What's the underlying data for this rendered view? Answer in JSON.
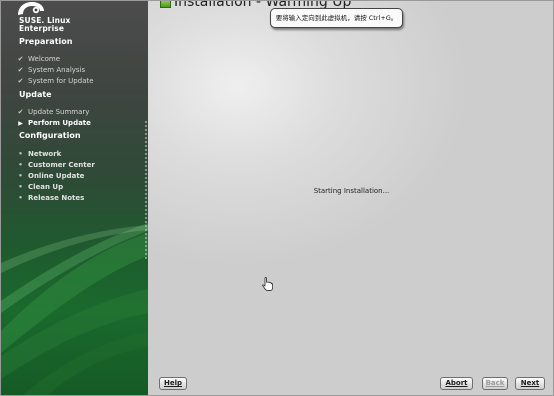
{
  "brand": {
    "line1": "SUSE. Linux",
    "line2": "Enterprise"
  },
  "sidebar": {
    "sections": [
      {
        "title": "Preparation",
        "items": [
          {
            "label": "Welcome",
            "state": "done"
          },
          {
            "label": "System Analysis",
            "state": "done"
          },
          {
            "label": "System for Update",
            "state": "done"
          }
        ]
      },
      {
        "title": "Update",
        "items": [
          {
            "label": "Update Summary",
            "state": "done"
          },
          {
            "label": "Perform Update",
            "state": "current"
          }
        ]
      },
      {
        "title": "Configuration",
        "items": [
          {
            "label": "Network",
            "state": "todo"
          },
          {
            "label": "Customer Center",
            "state": "todo"
          },
          {
            "label": "Online Update",
            "state": "todo"
          },
          {
            "label": "Clean Up",
            "state": "todo"
          },
          {
            "label": "Release Notes",
            "state": "todo"
          }
        ]
      }
    ]
  },
  "main": {
    "title": "Installation - Warming Up",
    "tooltip": "要将输入定向到此虚拟机，请按 Ctrl+G。",
    "status": "Starting Installation..."
  },
  "buttons": {
    "help": "Help",
    "abort": "Abort",
    "back": "Back",
    "next": "Next"
  },
  "icons": {
    "done": "checkmark-icon",
    "current": "triangle-right-icon",
    "todo": "bullet-icon"
  },
  "colors": {
    "sidebar_green": "#1a6a2d",
    "title_icon_green": "#4f9a1c"
  }
}
